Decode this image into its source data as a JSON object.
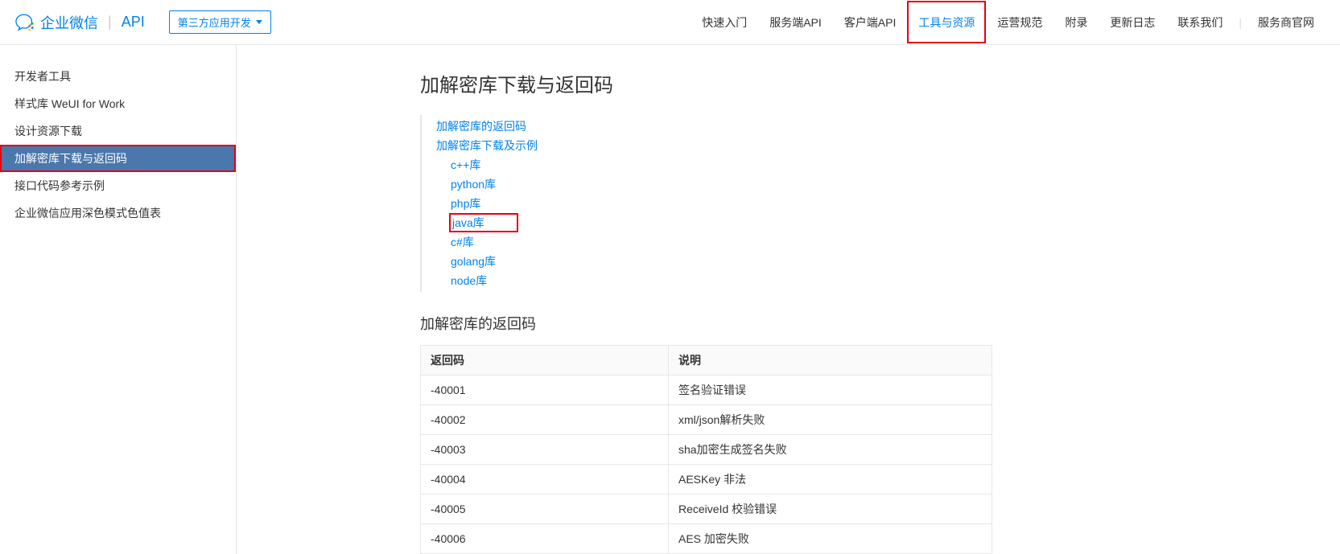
{
  "header": {
    "brand": "企业微信",
    "api_label": "API",
    "dropdown": "第三方应用开发",
    "nav": [
      {
        "label": "快速入门"
      },
      {
        "label": "服务端API"
      },
      {
        "label": "客户端API"
      },
      {
        "label": "工具与资源",
        "active": true
      },
      {
        "label": "运营规范"
      },
      {
        "label": "附录"
      },
      {
        "label": "更新日志"
      },
      {
        "label": "联系我们"
      }
    ],
    "nav_after": "服务商官网"
  },
  "sidebar": {
    "items": [
      {
        "label": "开发者工具"
      },
      {
        "label": "样式库 WeUI for Work"
      },
      {
        "label": "设计资源下载"
      },
      {
        "label": "加解密库下载与返回码",
        "active": true
      },
      {
        "label": "接口代码参考示例"
      },
      {
        "label": "企业微信应用深色模式色值表"
      }
    ]
  },
  "content": {
    "title": "加解密库下载与返回码",
    "toc": {
      "l1a": "加解密库的返回码",
      "l1b": "加解密库下载及示例",
      "l2": [
        {
          "label": "c++库"
        },
        {
          "label": "python库"
        },
        {
          "label": "php库"
        },
        {
          "label": "java库",
          "highlight": true
        },
        {
          "label": "c#库"
        },
        {
          "label": "golang库"
        },
        {
          "label": "node库"
        }
      ]
    },
    "section1_title": "加解密库的返回码",
    "table": {
      "headers": [
        "返回码",
        "说明"
      ],
      "rows": [
        [
          "-40001",
          "签名验证错误"
        ],
        [
          "-40002",
          "xml/json解析失败"
        ],
        [
          "-40003",
          "sha加密生成签名失败"
        ],
        [
          "-40004",
          "AESKey 非法"
        ],
        [
          "-40005",
          "ReceiveId 校验错误"
        ],
        [
          "-40006",
          "AES 加密失败"
        ]
      ]
    }
  }
}
